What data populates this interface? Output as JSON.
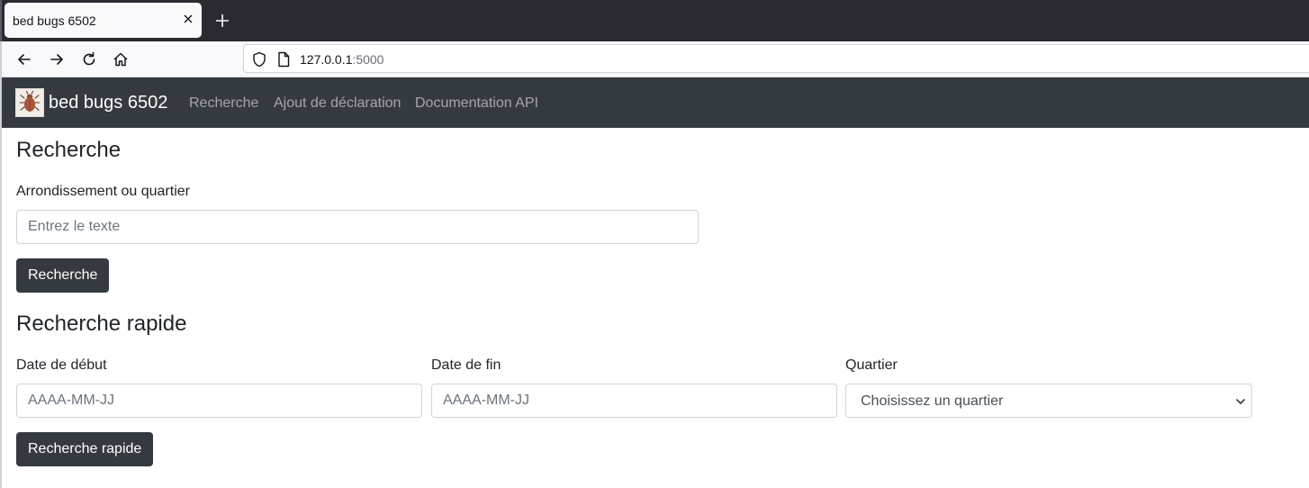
{
  "browser": {
    "tab_title": "bed bugs 6502",
    "url_host": "127.0.0.1",
    "url_port": ":5000"
  },
  "navbar": {
    "brand": "bed bugs 6502",
    "links": [
      "Recherche",
      "Ajout de déclaration",
      "Documentation API"
    ]
  },
  "search": {
    "title": "Recherche",
    "field_label": "Arrondissement ou quartier",
    "field_placeholder": "Entrez le texte",
    "button_label": "Recherche"
  },
  "quick_search": {
    "title": "Recherche rapide",
    "start_label": "Date de début",
    "start_placeholder": "AAAA-MM-JJ",
    "end_label": "Date de fin",
    "end_placeholder": "AAAA-MM-JJ",
    "district_label": "Quartier",
    "district_selected": "Choisissez un quartier",
    "button_label": "Recherche rapide"
  },
  "colors": {
    "navbar_bg": "#343a40",
    "button_bg": "#343a40",
    "nav_link": "rgba(255,255,255,0.55)"
  }
}
